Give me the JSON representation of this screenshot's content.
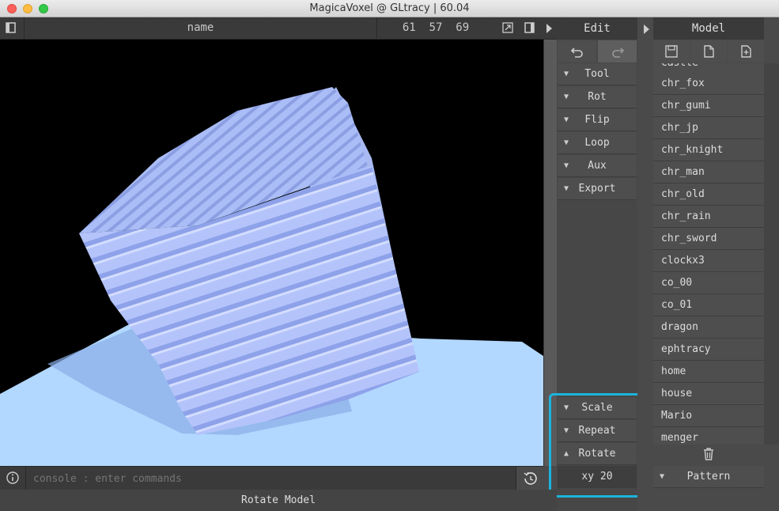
{
  "window": {
    "title": "MagicaVoxel @ GLtracy | 60.04"
  },
  "toolbar": {
    "name_label": "name",
    "dimensions": "61  57  69"
  },
  "edit_panel": {
    "title": "Edit",
    "sections": [
      "Tool",
      "Rot",
      "Flip",
      "Loop",
      "Aux",
      "Export"
    ],
    "bottom_sections": [
      "Scale",
      "Repeat",
      "Rotate"
    ],
    "rotate_value": "xy 20"
  },
  "model_panel": {
    "title": "Model",
    "items": [
      "castle",
      "chr_fox",
      "chr_gumi",
      "chr_jp",
      "chr_knight",
      "chr_man",
      "chr_old",
      "chr_rain",
      "chr_sword",
      "clockx3",
      "co_00",
      "co_01",
      "dragon",
      "ephtracy",
      "home",
      "house",
      "Mario",
      "menger"
    ],
    "pattern_label": "Pattern"
  },
  "console": {
    "placeholder": "console : enter commands"
  },
  "status": {
    "text": "Rotate Model"
  },
  "colors": {
    "accent": "#1bb4dc",
    "voxel": "#b4c8ff",
    "ground": "#b0d8ff"
  }
}
